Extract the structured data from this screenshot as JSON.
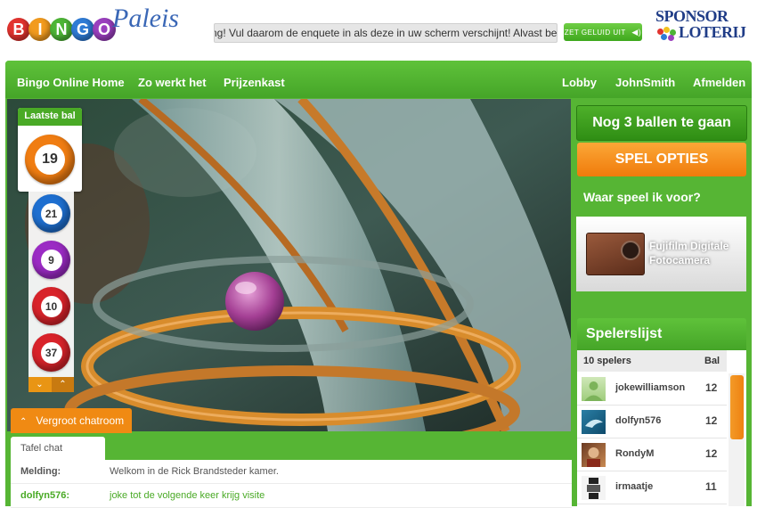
{
  "header": {
    "logo_letters": [
      "B",
      "I",
      "N",
      "G",
      "O"
    ],
    "logo_colors": [
      "#e2342f",
      "#f29b1e",
      "#4db536",
      "#2f7bd5",
      "#9a3fbe"
    ],
    "logo_script": "Paleis",
    "ticker_text": "ng! Vul daarom de enquete in als deze in uw scherm verschijnt! Alvast bedankt!",
    "sound_button": "ZET GELUID UIT",
    "sponsor_line1": "SPONSOR",
    "sponsor_line2": "LOTERIJ"
  },
  "nav": {
    "left": [
      "Bingo Online Home",
      "Zo werkt het",
      "Prijzenkast"
    ],
    "right": [
      "Lobby",
      "JohnSmith",
      "Afmelden"
    ]
  },
  "last_ball": {
    "title": "Laatste bal",
    "number": "19",
    "color": "#f07d12"
  },
  "ball_history": [
    {
      "number": "21",
      "color": "#1e6fd0"
    },
    {
      "number": "9",
      "color": "#9b2bc4"
    },
    {
      "number": "10",
      "color": "#d8232a"
    },
    {
      "number": "37",
      "color": "#d8232a"
    }
  ],
  "vergroot_label": "Vergroot chatroom",
  "chat": {
    "tab": "Tafel chat",
    "messages": [
      {
        "who": "Melding:",
        "msg": "Welkom in de Rick Brandsteder kamer.",
        "color": "#555555"
      },
      {
        "who": "dolfyn576:",
        "msg": "joke tot de volgende keer krijg visite",
        "color": "#4aaa26"
      }
    ]
  },
  "right": {
    "balls_left": "Nog 3 ballen te gaan",
    "options_button": "SPEL OPTIES",
    "prize_title": "Waar speel ik voor?",
    "prize_name": "Fujifilm Digitale Fotocamera",
    "players_title": "Spelerslijst",
    "players_count": "10 spelers",
    "players_col_score": "Bal",
    "players": [
      {
        "name": "jokewilliamson",
        "score": "12"
      },
      {
        "name": "dolfyn576",
        "score": "12"
      },
      {
        "name": "RondyM",
        "score": "12"
      },
      {
        "name": "irmaatje",
        "score": "11"
      }
    ]
  }
}
